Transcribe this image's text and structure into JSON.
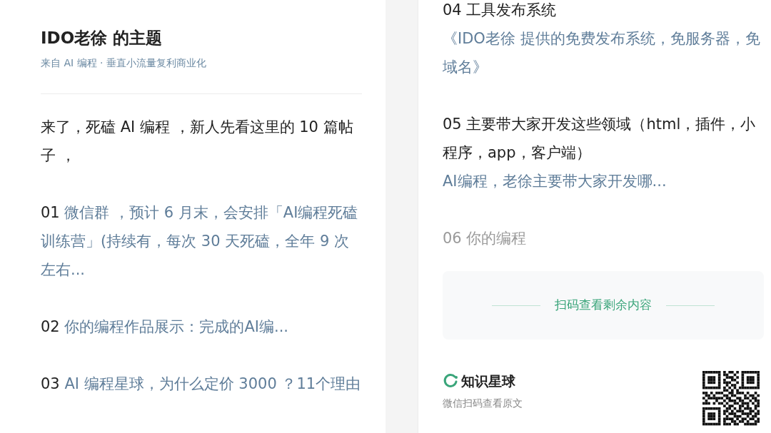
{
  "left": {
    "title": "IDO老徐 的主题",
    "source": "来自 AI 编程 · 垂直小流量复利商业化",
    "intro": "来了，死磕 AI 编程 ，新人先看这里的 10 篇帖子 ，",
    "posts": [
      {
        "kind": "inline",
        "number": "01",
        "link": "微信群 ，预计 6 月末，会安排「AI编程死磕训练营」(持续有，每次 30 天死磕，全年 9 次左右..."
      },
      {
        "kind": "inline",
        "number": "02",
        "link": "你的编程作品展示：完成的AI编..."
      },
      {
        "kind": "inline",
        "number": "03",
        "link": "AI 编程星球，为什么定价 3000 ？11个理由"
      }
    ]
  },
  "right": {
    "posts": [
      {
        "kind": "block",
        "number": "04",
        "title": "工具发布系统",
        "link": "《IDO老徐  提供的免费发布系统，免服务器，免域名》"
      },
      {
        "kind": "block",
        "number": "05",
        "title": "主要带大家开发这些领域（html，插件，小程序，app，客户端）",
        "link": "AI编程，老徐主要带大家开发哪..."
      },
      {
        "kind": "faded",
        "number": "06",
        "title": "你的编程"
      }
    ],
    "more_button": "扫码查看剩余内容",
    "brand": "知识星球",
    "scan_hint": "微信扫码查看原文"
  }
}
